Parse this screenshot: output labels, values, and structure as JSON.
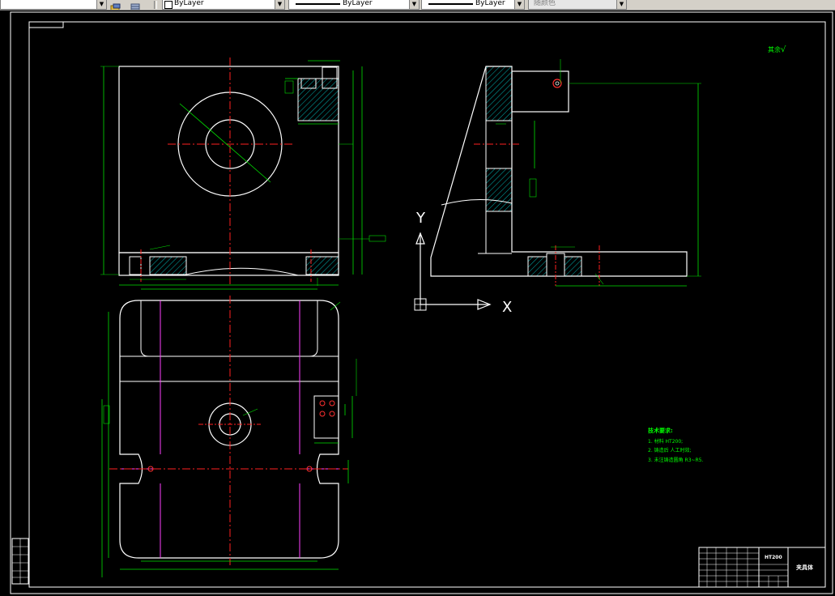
{
  "toolbar": {
    "layer_label": "ByLayer",
    "linetype_label": "ByLayer",
    "lineweight_label": "ByLayer",
    "color_label": "随颜色"
  },
  "drawing": {
    "roughness_note": "其余",
    "roughness_mark": "√",
    "axis_y": "Y",
    "axis_x": "X",
    "tech_title": "技术要求:",
    "tech_items": [
      "1. 材料 HT200;",
      "2. 铸造后 人工时效;",
      "3. 未注铸造圆角 R3~R5."
    ],
    "title_block_part": "夹具体",
    "title_block_ref": "HT200",
    "colors": {
      "outline": "#ffffff",
      "center": "#ff2020",
      "dimension": "#00e000",
      "hatch": "#00e0e0",
      "hidden": "#ff40ff",
      "note": "#00ff00"
    }
  }
}
